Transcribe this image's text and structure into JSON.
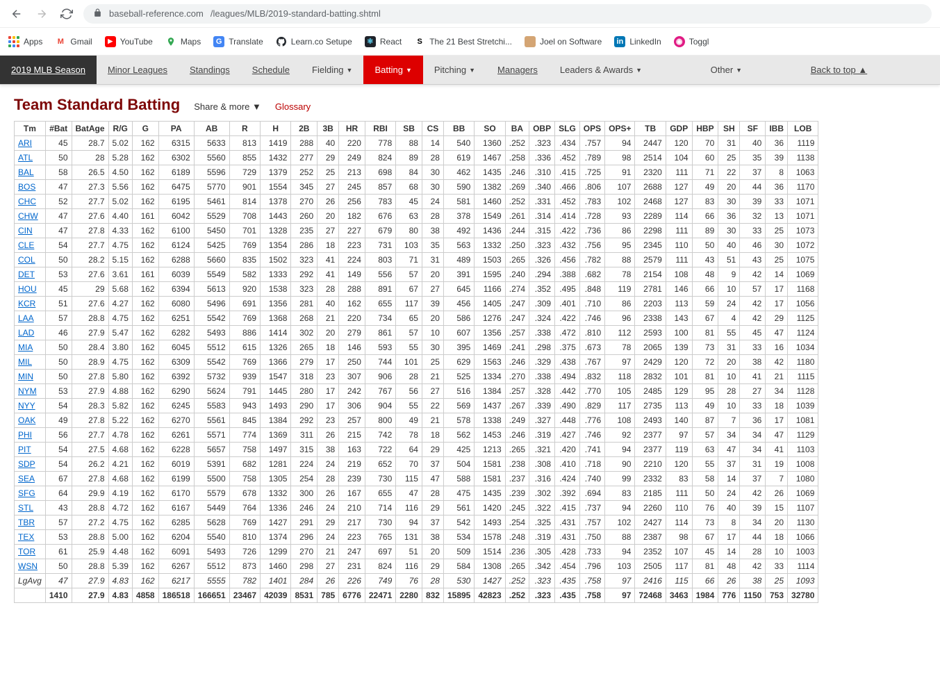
{
  "browser": {
    "url_host": "baseball-reference.com",
    "url_path": "/leagues/MLB/2019-standard-batting.shtml"
  },
  "bookmarks": [
    {
      "label": "Apps"
    },
    {
      "label": "Gmail"
    },
    {
      "label": "YouTube"
    },
    {
      "label": "Maps"
    },
    {
      "label": "Translate"
    },
    {
      "label": "Learn.co Setupe"
    },
    {
      "label": "React"
    },
    {
      "label": "The 21 Best Stretchi..."
    },
    {
      "label": "Joel on Software"
    },
    {
      "label": "LinkedIn"
    },
    {
      "label": "Toggl"
    }
  ],
  "site_nav": [
    {
      "label": "2019 MLB Season",
      "kind": "active-dark"
    },
    {
      "label": "Minor Leagues",
      "kind": "link-style"
    },
    {
      "label": "Standings",
      "kind": "link-style"
    },
    {
      "label": "Schedule",
      "kind": "link-style"
    },
    {
      "label": "Fielding",
      "kind": "dropdown"
    },
    {
      "label": "Batting",
      "kind": "active-red-dropdown"
    },
    {
      "label": "Pitching",
      "kind": "dropdown"
    },
    {
      "label": "Managers",
      "kind": "link-style"
    },
    {
      "label": "Leaders & Awards",
      "kind": "dropdown"
    },
    {
      "label": "Other",
      "kind": "dropdown"
    },
    {
      "label": "Back to top ▲",
      "kind": "link-style-right"
    }
  ],
  "page": {
    "title": "Team Standard Batting",
    "share": "Share & more ▼",
    "glossary": "Glossary"
  },
  "table": {
    "headers": [
      "Tm",
      "#Bat",
      "BatAge",
      "R/G",
      "G",
      "PA",
      "AB",
      "R",
      "H",
      "2B",
      "3B",
      "HR",
      "RBI",
      "SB",
      "CS",
      "BB",
      "SO",
      "BA",
      "OBP",
      "SLG",
      "OPS",
      "OPS+",
      "TB",
      "GDP",
      "HBP",
      "SH",
      "SF",
      "IBB",
      "LOB"
    ],
    "rows": [
      [
        "ARI",
        45,
        28.7,
        "5.02",
        162,
        6315,
        5633,
        813,
        1419,
        288,
        40,
        220,
        778,
        88,
        14,
        540,
        1360,
        ".252",
        ".323",
        ".434",
        ".757",
        94,
        2447,
        120,
        70,
        31,
        40,
        36,
        1119
      ],
      [
        "ATL",
        50,
        28.0,
        "5.28",
        162,
        6302,
        5560,
        855,
        1432,
        277,
        29,
        249,
        824,
        89,
        28,
        619,
        1467,
        ".258",
        ".336",
        ".452",
        ".789",
        98,
        2514,
        104,
        60,
        25,
        35,
        39,
        1138
      ],
      [
        "BAL",
        58,
        26.5,
        "4.50",
        162,
        6189,
        5596,
        729,
        1379,
        252,
        25,
        213,
        698,
        84,
        30,
        462,
        1435,
        ".246",
        ".310",
        ".415",
        ".725",
        91,
        2320,
        111,
        71,
        22,
        37,
        8,
        1063
      ],
      [
        "BOS",
        47,
        27.3,
        "5.56",
        162,
        6475,
        5770,
        901,
        1554,
        345,
        27,
        245,
        857,
        68,
        30,
        590,
        1382,
        ".269",
        ".340",
        ".466",
        ".806",
        107,
        2688,
        127,
        49,
        20,
        44,
        36,
        1170
      ],
      [
        "CHC",
        52,
        27.7,
        "5.02",
        162,
        6195,
        5461,
        814,
        1378,
        270,
        26,
        256,
        783,
        45,
        24,
        581,
        1460,
        ".252",
        ".331",
        ".452",
        ".783",
        102,
        2468,
        127,
        83,
        30,
        39,
        33,
        1071
      ],
      [
        "CHW",
        47,
        27.6,
        "4.40",
        161,
        6042,
        5529,
        708,
        1443,
        260,
        20,
        182,
        676,
        63,
        28,
        378,
        1549,
        ".261",
        ".314",
        ".414",
        ".728",
        93,
        2289,
        114,
        66,
        36,
        32,
        13,
        1071
      ],
      [
        "CIN",
        47,
        27.8,
        "4.33",
        162,
        6100,
        5450,
        701,
        1328,
        235,
        27,
        227,
        679,
        80,
        38,
        492,
        1436,
        ".244",
        ".315",
        ".422",
        ".736",
        86,
        2298,
        111,
        89,
        30,
        33,
        25,
        1073
      ],
      [
        "CLE",
        54,
        27.7,
        "4.75",
        162,
        6124,
        5425,
        769,
        1354,
        286,
        18,
        223,
        731,
        103,
        35,
        563,
        1332,
        ".250",
        ".323",
        ".432",
        ".756",
        95,
        2345,
        110,
        50,
        40,
        46,
        30,
        1072
      ],
      [
        "COL",
        50,
        28.2,
        "5.15",
        162,
        6288,
        5660,
        835,
        1502,
        323,
        41,
        224,
        803,
        71,
        31,
        489,
        1503,
        ".265",
        ".326",
        ".456",
        ".782",
        88,
        2579,
        111,
        43,
        51,
        43,
        25,
        1075
      ],
      [
        "DET",
        53,
        27.6,
        "3.61",
        161,
        6039,
        5549,
        582,
        1333,
        292,
        41,
        149,
        556,
        57,
        20,
        391,
        1595,
        ".240",
        ".294",
        ".388",
        ".682",
        78,
        2154,
        108,
        48,
        9,
        42,
        14,
        1069
      ],
      [
        "HOU",
        45,
        29.0,
        "5.68",
        162,
        6394,
        5613,
        920,
        1538,
        323,
        28,
        288,
        891,
        67,
        27,
        645,
        1166,
        ".274",
        ".352",
        ".495",
        ".848",
        119,
        2781,
        146,
        66,
        10,
        57,
        17,
        1168
      ],
      [
        "KCR",
        51,
        27.6,
        "4.27",
        162,
        6080,
        5496,
        691,
        1356,
        281,
        40,
        162,
        655,
        117,
        39,
        456,
        1405,
        ".247",
        ".309",
        ".401",
        ".710",
        86,
        2203,
        113,
        59,
        24,
        42,
        17,
        1056
      ],
      [
        "LAA",
        57,
        28.8,
        "4.75",
        162,
        6251,
        5542,
        769,
        1368,
        268,
        21,
        220,
        734,
        65,
        20,
        586,
        1276,
        ".247",
        ".324",
        ".422",
        ".746",
        96,
        2338,
        143,
        67,
        4,
        42,
        29,
        1125
      ],
      [
        "LAD",
        46,
        27.9,
        "5.47",
        162,
        6282,
        5493,
        886,
        1414,
        302,
        20,
        279,
        861,
        57,
        10,
        607,
        1356,
        ".257",
        ".338",
        ".472",
        ".810",
        112,
        2593,
        100,
        81,
        55,
        45,
        47,
        1124
      ],
      [
        "MIA",
        50,
        28.4,
        "3.80",
        162,
        6045,
        5512,
        615,
        1326,
        265,
        18,
        146,
        593,
        55,
        30,
        395,
        1469,
        ".241",
        ".298",
        ".375",
        ".673",
        78,
        2065,
        139,
        73,
        31,
        33,
        16,
        1034
      ],
      [
        "MIL",
        50,
        28.9,
        "4.75",
        162,
        6309,
        5542,
        769,
        1366,
        279,
        17,
        250,
        744,
        101,
        25,
        629,
        1563,
        ".246",
        ".329",
        ".438",
        ".767",
        97,
        2429,
        120,
        72,
        20,
        38,
        42,
        1180
      ],
      [
        "MIN",
        50,
        27.8,
        "5.80",
        162,
        6392,
        5732,
        939,
        1547,
        318,
        23,
        307,
        906,
        28,
        21,
        525,
        1334,
        ".270",
        ".338",
        ".494",
        ".832",
        118,
        2832,
        101,
        81,
        10,
        41,
        21,
        1115
      ],
      [
        "NYM",
        53,
        27.9,
        "4.88",
        162,
        6290,
        5624,
        791,
        1445,
        280,
        17,
        242,
        767,
        56,
        27,
        516,
        1384,
        ".257",
        ".328",
        ".442",
        ".770",
        105,
        2485,
        129,
        95,
        28,
        27,
        34,
        1128
      ],
      [
        "NYY",
        54,
        28.3,
        "5.82",
        162,
        6245,
        5583,
        943,
        1493,
        290,
        17,
        306,
        904,
        55,
        22,
        569,
        1437,
        ".267",
        ".339",
        ".490",
        ".829",
        117,
        2735,
        113,
        49,
        10,
        33,
        18,
        1039
      ],
      [
        "OAK",
        49,
        27.8,
        "5.22",
        162,
        6270,
        5561,
        845,
        1384,
        292,
        23,
        257,
        800,
        49,
        21,
        578,
        1338,
        ".249",
        ".327",
        ".448",
        ".776",
        108,
        2493,
        140,
        87,
        7,
        36,
        17,
        1081
      ],
      [
        "PHI",
        56,
        27.7,
        "4.78",
        162,
        6261,
        5571,
        774,
        1369,
        311,
        26,
        215,
        742,
        78,
        18,
        562,
        1453,
        ".246",
        ".319",
        ".427",
        ".746",
        92,
        2377,
        97,
        57,
        34,
        34,
        47,
        1129
      ],
      [
        "PIT",
        54,
        27.5,
        "4.68",
        162,
        6228,
        5657,
        758,
        1497,
        315,
        38,
        163,
        722,
        64,
        29,
        425,
        1213,
        ".265",
        ".321",
        ".420",
        ".741",
        94,
        2377,
        119,
        63,
        47,
        34,
        41,
        1103
      ],
      [
        "SDP",
        54,
        26.2,
        "4.21",
        162,
        6019,
        5391,
        682,
        1281,
        224,
        24,
        219,
        652,
        70,
        37,
        504,
        1581,
        ".238",
        ".308",
        ".410",
        ".718",
        90,
        2210,
        120,
        55,
        37,
        31,
        19,
        1008
      ],
      [
        "SEA",
        67,
        27.8,
        "4.68",
        162,
        6199,
        5500,
        758,
        1305,
        254,
        28,
        239,
        730,
        115,
        47,
        588,
        1581,
        ".237",
        ".316",
        ".424",
        ".740",
        99,
        2332,
        83,
        58,
        14,
        37,
        7,
        1080
      ],
      [
        "SFG",
        64,
        29.9,
        "4.19",
        162,
        6170,
        5579,
        678,
        1332,
        300,
        26,
        167,
        655,
        47,
        28,
        475,
        1435,
        ".239",
        ".302",
        ".392",
        ".694",
        83,
        2185,
        111,
        50,
        24,
        42,
        26,
        1069
      ],
      [
        "STL",
        43,
        28.8,
        "4.72",
        162,
        6167,
        5449,
        764,
        1336,
        246,
        24,
        210,
        714,
        116,
        29,
        561,
        1420,
        ".245",
        ".322",
        ".415",
        ".737",
        94,
        2260,
        110,
        76,
        40,
        39,
        15,
        1107
      ],
      [
        "TBR",
        57,
        27.2,
        "4.75",
        162,
        6285,
        5628,
        769,
        1427,
        291,
        29,
        217,
        730,
        94,
        37,
        542,
        1493,
        ".254",
        ".325",
        ".431",
        ".757",
        102,
        2427,
        114,
        73,
        8,
        34,
        20,
        1130
      ],
      [
        "TEX",
        53,
        28.8,
        "5.00",
        162,
        6204,
        5540,
        810,
        1374,
        296,
        24,
        223,
        765,
        131,
        38,
        534,
        1578,
        ".248",
        ".319",
        ".431",
        ".750",
        88,
        2387,
        98,
        67,
        17,
        44,
        18,
        1066
      ],
      [
        "TOR",
        61,
        25.9,
        "4.48",
        162,
        6091,
        5493,
        726,
        1299,
        270,
        21,
        247,
        697,
        51,
        20,
        509,
        1514,
        ".236",
        ".305",
        ".428",
        ".733",
        94,
        2352,
        107,
        45,
        14,
        28,
        10,
        1003
      ],
      [
        "WSN",
        50,
        28.8,
        "5.39",
        162,
        6267,
        5512,
        873,
        1460,
        298,
        27,
        231,
        824,
        116,
        29,
        584,
        1308,
        ".265",
        ".342",
        ".454",
        ".796",
        103,
        2505,
        117,
        81,
        48,
        42,
        33,
        1114
      ]
    ],
    "lg_avg": [
      "LgAvg",
      47,
      27.9,
      "4.83",
      162,
      6217,
      5555,
      782,
      1401,
      284,
      26,
      226,
      749,
      76,
      28,
      530,
      1427,
      ".252",
      ".323",
      ".435",
      ".758",
      97,
      2416,
      115,
      66,
      26,
      38,
      25,
      1093
    ],
    "totals": [
      "",
      1410,
      27.9,
      "4.83",
      4858,
      186518,
      166651,
      23467,
      42039,
      8531,
      785,
      6776,
      22471,
      2280,
      832,
      15895,
      42823,
      ".252",
      ".323",
      ".435",
      ".758",
      97,
      72468,
      3463,
      1984,
      776,
      1150,
      753,
      32780
    ]
  }
}
